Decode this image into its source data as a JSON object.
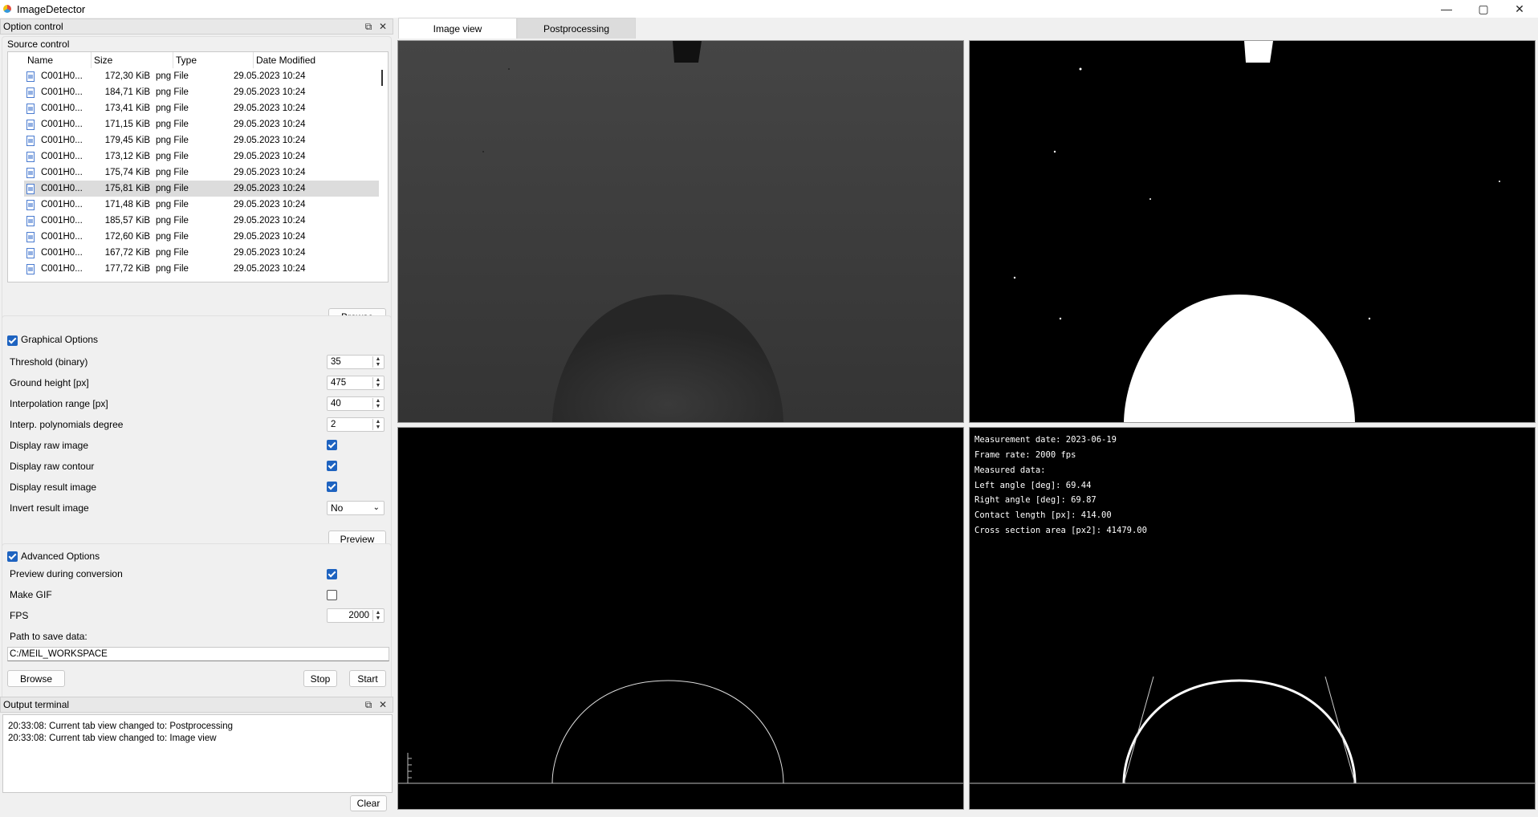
{
  "window": {
    "title": "ImageDetector",
    "minimize": "—",
    "maximize": "▢",
    "close": "✕"
  },
  "option_control": {
    "title": "Option control",
    "source_control": {
      "title": "Source control",
      "columns": [
        "Name",
        "Size",
        "Type",
        "Date Modified"
      ],
      "files": [
        {
          "name": "C001H0...",
          "size": "172,30 KiB",
          "type": "png File",
          "date": "29.05.2023 10:24"
        },
        {
          "name": "C001H0...",
          "size": "184,71 KiB",
          "type": "png File",
          "date": "29.05.2023 10:24"
        },
        {
          "name": "C001H0...",
          "size": "173,41 KiB",
          "type": "png File",
          "date": "29.05.2023 10:24"
        },
        {
          "name": "C001H0...",
          "size": "171,15 KiB",
          "type": "png File",
          "date": "29.05.2023 10:24"
        },
        {
          "name": "C001H0...",
          "size": "179,45 KiB",
          "type": "png File",
          "date": "29.05.2023 10:24"
        },
        {
          "name": "C001H0...",
          "size": "173,12 KiB",
          "type": "png File",
          "date": "29.05.2023 10:24"
        },
        {
          "name": "C001H0...",
          "size": "175,74 KiB",
          "type": "png File",
          "date": "29.05.2023 10:24"
        },
        {
          "name": "C001H0...",
          "size": "175,81 KiB",
          "type": "png File",
          "date": "29.05.2023 10:24"
        },
        {
          "name": "C001H0...",
          "size": "171,48 KiB",
          "type": "png File",
          "date": "29.05.2023 10:24"
        },
        {
          "name": "C001H0...",
          "size": "185,57 KiB",
          "type": "png File",
          "date": "29.05.2023 10:24"
        },
        {
          "name": "C001H0...",
          "size": "172,60 KiB",
          "type": "png File",
          "date": "29.05.2023 10:24"
        },
        {
          "name": "C001H0...",
          "size": "167,72 KiB",
          "type": "png File",
          "date": "29.05.2023 10:24"
        },
        {
          "name": "C001H0...",
          "size": "177,72 KiB",
          "type": "png File",
          "date": "29.05.2023 10:24"
        }
      ],
      "selected_index": 7,
      "browse_label": "Browse"
    },
    "graphical_options": {
      "title": "Graphical Options",
      "checked": true,
      "threshold_label": "Threshold (binary)",
      "threshold_value": "35",
      "ground_label": "Ground height [px]",
      "ground_value": "475",
      "interp_range_label": "Interpolation range [px]",
      "interp_range_value": "40",
      "interp_degree_label": "Interp. polynomials degree",
      "interp_degree_value": "2",
      "raw_image_label": "Display raw image",
      "raw_image": true,
      "raw_contour_label": "Display raw contour",
      "raw_contour": true,
      "result_image_label": "Display result image",
      "result_image": true,
      "invert_label": "Invert result image",
      "invert_value": "No",
      "preview_label": "Preview"
    },
    "advanced_options": {
      "title": "Advanced Options",
      "checked": true,
      "preview_conv_label": "Preview during conversion",
      "preview_conv": true,
      "gif_label": "Make GIF",
      "gif": false,
      "fps_label": "FPS",
      "fps_value": "2000",
      "path_label": "Path to save data:",
      "path_value": "C:/MEIL_WORKSPACE",
      "browse_label": "Browse",
      "stop_label": "Stop",
      "start_label": "Start"
    }
  },
  "output_terminal": {
    "title": "Output terminal",
    "lines": [
      "20:33:08: Current tab view changed to: Postprocessing",
      "20:33:08: Current tab view changed to: Image view"
    ],
    "clear_label": "Clear"
  },
  "tabs": [
    {
      "label": "Image view",
      "active": true
    },
    {
      "label": "Postprocessing",
      "active": false
    }
  ],
  "measurement": {
    "lines": [
      "Measurement date: 2023-06-19",
      "Frame rate: 2000 fps",
      "Measured data:",
      "Left angle [deg]: 69.44",
      "Right angle [deg]: 69.87",
      "Contact length [px]: 414.00",
      "Cross section area [px2]: 41479.00"
    ]
  },
  "colors": {
    "accent": "#1e63c0",
    "view_bg": "#000000",
    "selection": "#dcdcdc"
  }
}
